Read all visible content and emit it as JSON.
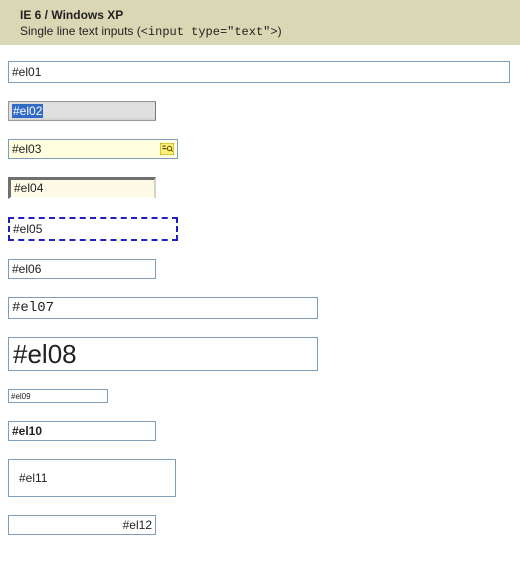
{
  "header": {
    "platform": "IE 6 / Windows XP",
    "subtitle_prefix": "Single line text inputs (",
    "subtitle_code": "<input type=\"text\">",
    "subtitle_suffix": ")"
  },
  "inputs": {
    "el01": "#el01",
    "el02": "#el02",
    "el03": "#el03",
    "el04": "#el04",
    "el05": "#el05",
    "el06": "#el06",
    "el07": "#el07",
    "el08": "#el08",
    "el09": "#el09",
    "el10": "#el10",
    "el11": "#el11",
    "el12": "#el12"
  }
}
